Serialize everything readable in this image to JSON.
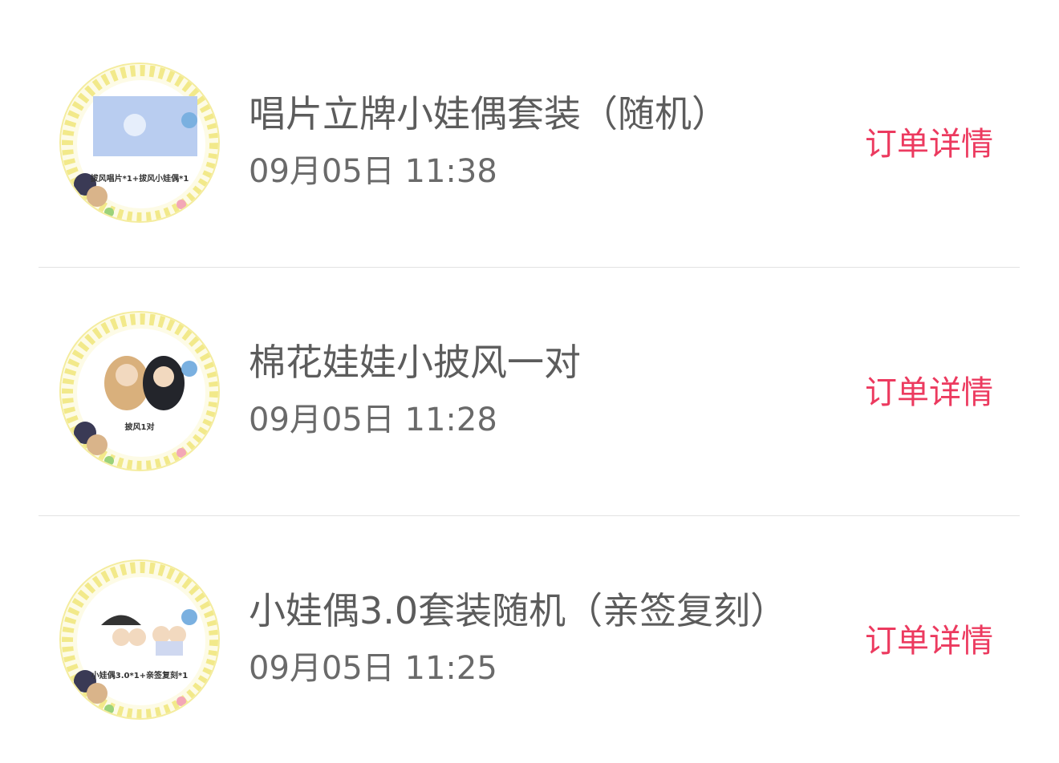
{
  "orders": [
    {
      "title": "唱片立牌小娃偶套装（随机）",
      "time": "09月05日 11:38",
      "detail_label": "订单详情",
      "thumb_caption": "拔风唱片*1+拔风小娃偶*1"
    },
    {
      "title": "棉花娃娃小披风一对",
      "time": "09月05日 11:28",
      "detail_label": "订单详情",
      "thumb_caption": "披风1对"
    },
    {
      "title": "小娃偶3.0套装随机（亲签复刻）",
      "time": "09月05日 11:25",
      "detail_label": "订单详情",
      "thumb_caption": "小娃偶3.0*1+亲签复刻*1"
    }
  ],
  "colors": {
    "accent": "#ec3a5f",
    "title_text": "#5c5c5c",
    "time_text": "#6a6a6a",
    "divider": "#e2e2e2",
    "thumb_frame": "#f4ec9e"
  }
}
